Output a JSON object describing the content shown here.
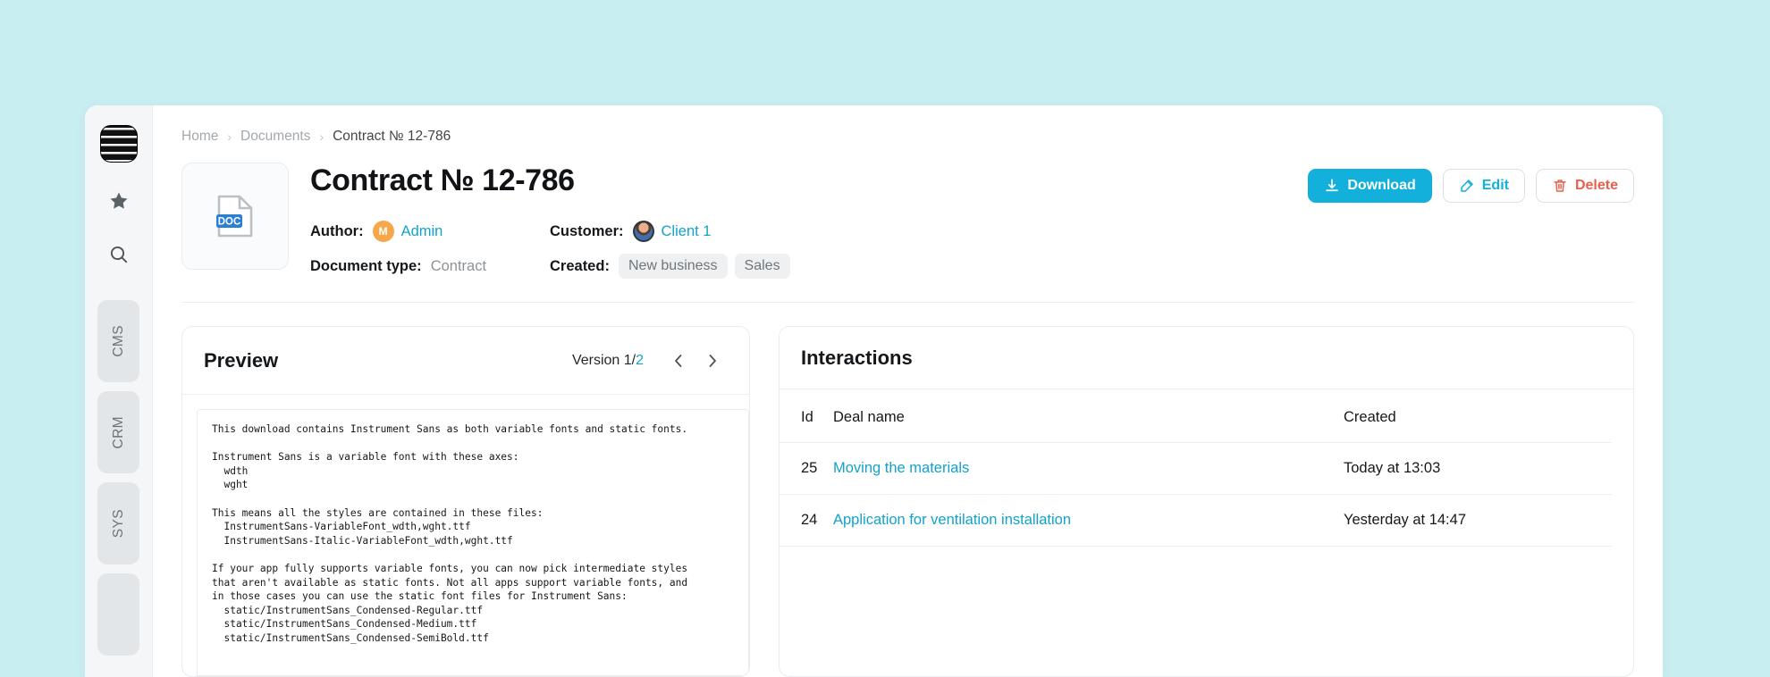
{
  "colors": {
    "page_background": "#c9eef2",
    "accent": "#12b0da",
    "link": "#12a3c9",
    "danger": "#e8604c",
    "sidebar_background": "#f4f6f7"
  },
  "sidebar": {
    "logo_name": "app-logo",
    "icons": [
      {
        "name": "star-icon",
        "label": "Favorites"
      },
      {
        "name": "search-icon",
        "label": "Search"
      }
    ],
    "tabs": [
      {
        "label": "CMS"
      },
      {
        "label": "CRM"
      },
      {
        "label": "SYS"
      },
      {
        "label": ""
      }
    ]
  },
  "breadcrumb": {
    "items": [
      {
        "label": "Home",
        "current": false
      },
      {
        "label": "Documents",
        "current": false
      },
      {
        "label": "Contract № 12-786",
        "current": true
      }
    ],
    "separator": "›"
  },
  "document": {
    "title": "Contract № 12-786",
    "thumbnail_icon": "doc-file-icon",
    "thumbnail_badge": "DOC",
    "fields": {
      "author_label": "Author:",
      "author_name": "Admin",
      "author_initial": "M",
      "customer_label": "Customer:",
      "customer_name": "Client 1",
      "doc_type_label": "Document type:",
      "doc_type_value": "Contract",
      "created_label": "Created:",
      "created_tags": [
        "New business",
        "Sales"
      ]
    }
  },
  "actions": {
    "download": "Download",
    "edit": "Edit",
    "delete": "Delete"
  },
  "preview": {
    "title": "Preview",
    "version_prefix": "Version 1/",
    "version_current": "2",
    "prev_arrow": "‹",
    "next_arrow": "›",
    "text": "This download contains Instrument Sans as both variable fonts and static fonts.\n\nInstrument Sans is a variable font with these axes:\n  wdth\n  wght\n\nThis means all the styles are contained in these files:\n  InstrumentSans-VariableFont_wdth,wght.ttf\n  InstrumentSans-Italic-VariableFont_wdth,wght.ttf\n\nIf your app fully supports variable fonts, you can now pick intermediate styles\nthat aren't available as static fonts. Not all apps support variable fonts, and\nin those cases you can use the static font files for Instrument Sans:\n  static/InstrumentSans_Condensed-Regular.ttf\n  static/InstrumentSans_Condensed-Medium.ttf\n  static/InstrumentSans_Condensed-SemiBold.ttf"
  },
  "interactions": {
    "title": "Interactions",
    "columns": [
      "Id",
      "Deal name",
      "Created"
    ],
    "rows": [
      {
        "id": "25",
        "deal_name": "Moving the materials",
        "created": "Today at 13:03"
      },
      {
        "id": "24",
        "deal_name": "Application for ventilation installation",
        "created": "Yesterday at 14:47"
      }
    ]
  }
}
